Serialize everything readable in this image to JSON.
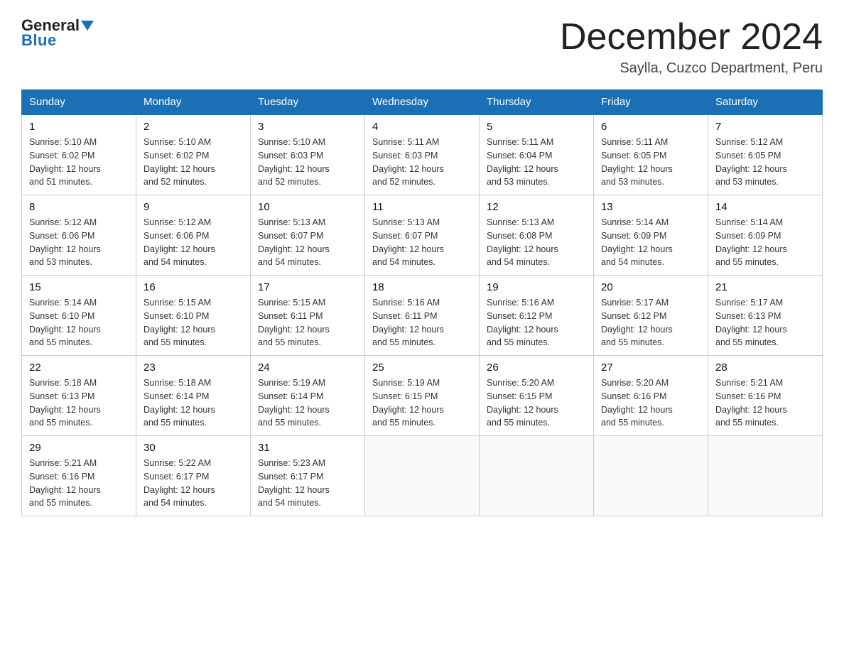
{
  "header": {
    "logo_general": "General",
    "logo_blue": "Blue",
    "title": "December 2024",
    "location": "Saylla, Cuzco Department, Peru"
  },
  "days_of_week": [
    "Sunday",
    "Monday",
    "Tuesday",
    "Wednesday",
    "Thursday",
    "Friday",
    "Saturday"
  ],
  "weeks": [
    [
      {
        "day": "1",
        "sunrise": "5:10 AM",
        "sunset": "6:02 PM",
        "daylight": "12 hours and 51 minutes."
      },
      {
        "day": "2",
        "sunrise": "5:10 AM",
        "sunset": "6:02 PM",
        "daylight": "12 hours and 52 minutes."
      },
      {
        "day": "3",
        "sunrise": "5:10 AM",
        "sunset": "6:03 PM",
        "daylight": "12 hours and 52 minutes."
      },
      {
        "day": "4",
        "sunrise": "5:11 AM",
        "sunset": "6:03 PM",
        "daylight": "12 hours and 52 minutes."
      },
      {
        "day": "5",
        "sunrise": "5:11 AM",
        "sunset": "6:04 PM",
        "daylight": "12 hours and 53 minutes."
      },
      {
        "day": "6",
        "sunrise": "5:11 AM",
        "sunset": "6:05 PM",
        "daylight": "12 hours and 53 minutes."
      },
      {
        "day": "7",
        "sunrise": "5:12 AM",
        "sunset": "6:05 PM",
        "daylight": "12 hours and 53 minutes."
      }
    ],
    [
      {
        "day": "8",
        "sunrise": "5:12 AM",
        "sunset": "6:06 PM",
        "daylight": "12 hours and 53 minutes."
      },
      {
        "day": "9",
        "sunrise": "5:12 AM",
        "sunset": "6:06 PM",
        "daylight": "12 hours and 54 minutes."
      },
      {
        "day": "10",
        "sunrise": "5:13 AM",
        "sunset": "6:07 PM",
        "daylight": "12 hours and 54 minutes."
      },
      {
        "day": "11",
        "sunrise": "5:13 AM",
        "sunset": "6:07 PM",
        "daylight": "12 hours and 54 minutes."
      },
      {
        "day": "12",
        "sunrise": "5:13 AM",
        "sunset": "6:08 PM",
        "daylight": "12 hours and 54 minutes."
      },
      {
        "day": "13",
        "sunrise": "5:14 AM",
        "sunset": "6:09 PM",
        "daylight": "12 hours and 54 minutes."
      },
      {
        "day": "14",
        "sunrise": "5:14 AM",
        "sunset": "6:09 PM",
        "daylight": "12 hours and 55 minutes."
      }
    ],
    [
      {
        "day": "15",
        "sunrise": "5:14 AM",
        "sunset": "6:10 PM",
        "daylight": "12 hours and 55 minutes."
      },
      {
        "day": "16",
        "sunrise": "5:15 AM",
        "sunset": "6:10 PM",
        "daylight": "12 hours and 55 minutes."
      },
      {
        "day": "17",
        "sunrise": "5:15 AM",
        "sunset": "6:11 PM",
        "daylight": "12 hours and 55 minutes."
      },
      {
        "day": "18",
        "sunrise": "5:16 AM",
        "sunset": "6:11 PM",
        "daylight": "12 hours and 55 minutes."
      },
      {
        "day": "19",
        "sunrise": "5:16 AM",
        "sunset": "6:12 PM",
        "daylight": "12 hours and 55 minutes."
      },
      {
        "day": "20",
        "sunrise": "5:17 AM",
        "sunset": "6:12 PM",
        "daylight": "12 hours and 55 minutes."
      },
      {
        "day": "21",
        "sunrise": "5:17 AM",
        "sunset": "6:13 PM",
        "daylight": "12 hours and 55 minutes."
      }
    ],
    [
      {
        "day": "22",
        "sunrise": "5:18 AM",
        "sunset": "6:13 PM",
        "daylight": "12 hours and 55 minutes."
      },
      {
        "day": "23",
        "sunrise": "5:18 AM",
        "sunset": "6:14 PM",
        "daylight": "12 hours and 55 minutes."
      },
      {
        "day": "24",
        "sunrise": "5:19 AM",
        "sunset": "6:14 PM",
        "daylight": "12 hours and 55 minutes."
      },
      {
        "day": "25",
        "sunrise": "5:19 AM",
        "sunset": "6:15 PM",
        "daylight": "12 hours and 55 minutes."
      },
      {
        "day": "26",
        "sunrise": "5:20 AM",
        "sunset": "6:15 PM",
        "daylight": "12 hours and 55 minutes."
      },
      {
        "day": "27",
        "sunrise": "5:20 AM",
        "sunset": "6:16 PM",
        "daylight": "12 hours and 55 minutes."
      },
      {
        "day": "28",
        "sunrise": "5:21 AM",
        "sunset": "6:16 PM",
        "daylight": "12 hours and 55 minutes."
      }
    ],
    [
      {
        "day": "29",
        "sunrise": "5:21 AM",
        "sunset": "6:16 PM",
        "daylight": "12 hours and 55 minutes."
      },
      {
        "day": "30",
        "sunrise": "5:22 AM",
        "sunset": "6:17 PM",
        "daylight": "12 hours and 54 minutes."
      },
      {
        "day": "31",
        "sunrise": "5:23 AM",
        "sunset": "6:17 PM",
        "daylight": "12 hours and 54 minutes."
      },
      null,
      null,
      null,
      null
    ]
  ],
  "labels": {
    "sunrise": "Sunrise:",
    "sunset": "Sunset:",
    "daylight": "Daylight:"
  }
}
